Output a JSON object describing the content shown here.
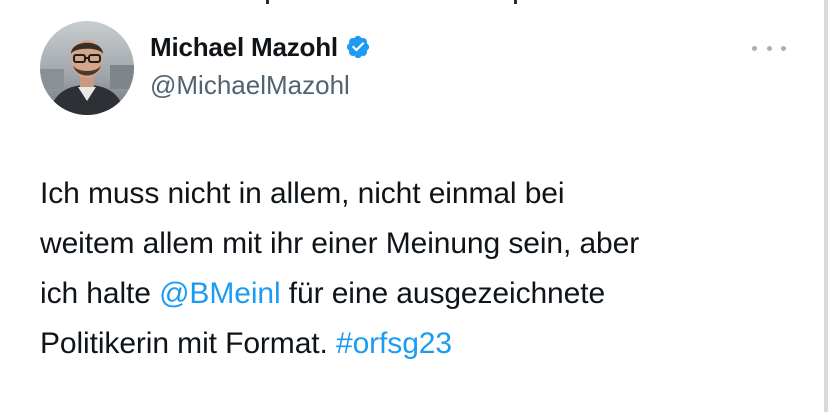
{
  "tweet": {
    "author": {
      "display_name": "Michael Mazohl",
      "handle": "@MichaelMazohl",
      "verified": true,
      "avatar_icon": "profile-photo"
    },
    "more_icon": "more-options-icon",
    "text": {
      "line1": "Ich muss nicht in allem, nicht einmal bei",
      "line2": "weitem allem mit ihr einer Meinung sein, aber",
      "line3_prefix": "ich halte ",
      "mention": "@BMeinl",
      "line3_suffix": " für eine ausgezeichnete",
      "line4_prefix": "Politikerin mit Format. ",
      "hashtag": "#orfsg23"
    }
  },
  "colors": {
    "text": "#0f1419",
    "secondary": "#536471",
    "link": "#1d9bf0",
    "verified": "#1d9bf0"
  }
}
